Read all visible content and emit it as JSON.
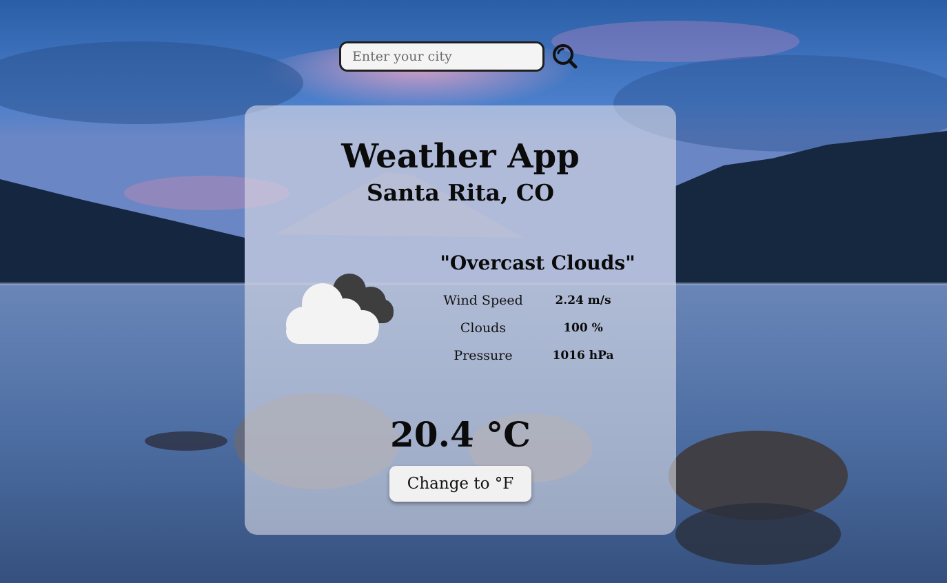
{
  "search": {
    "placeholder": "Enter your city",
    "value": "",
    "icon": "magnifier-icon"
  },
  "card": {
    "title": "Weather App",
    "location": "Santa Rita, CO",
    "condition_icon": "overcast-clouds-icon",
    "description": "\"Overcast Clouds\"",
    "stats": [
      {
        "label": "Wind Speed",
        "value": "2.24 m/s"
      },
      {
        "label": "Clouds",
        "value": "100 %"
      },
      {
        "label": "Pressure",
        "value": "1016 hPa"
      }
    ],
    "temperature": "20.4 °C",
    "unit_button_label": "Change to °F"
  },
  "colors": {
    "card_background": "#e1e1eb",
    "text": "#0b0b0b",
    "button_background": "#f1f1f1",
    "search_border": "#1f1f1f"
  }
}
